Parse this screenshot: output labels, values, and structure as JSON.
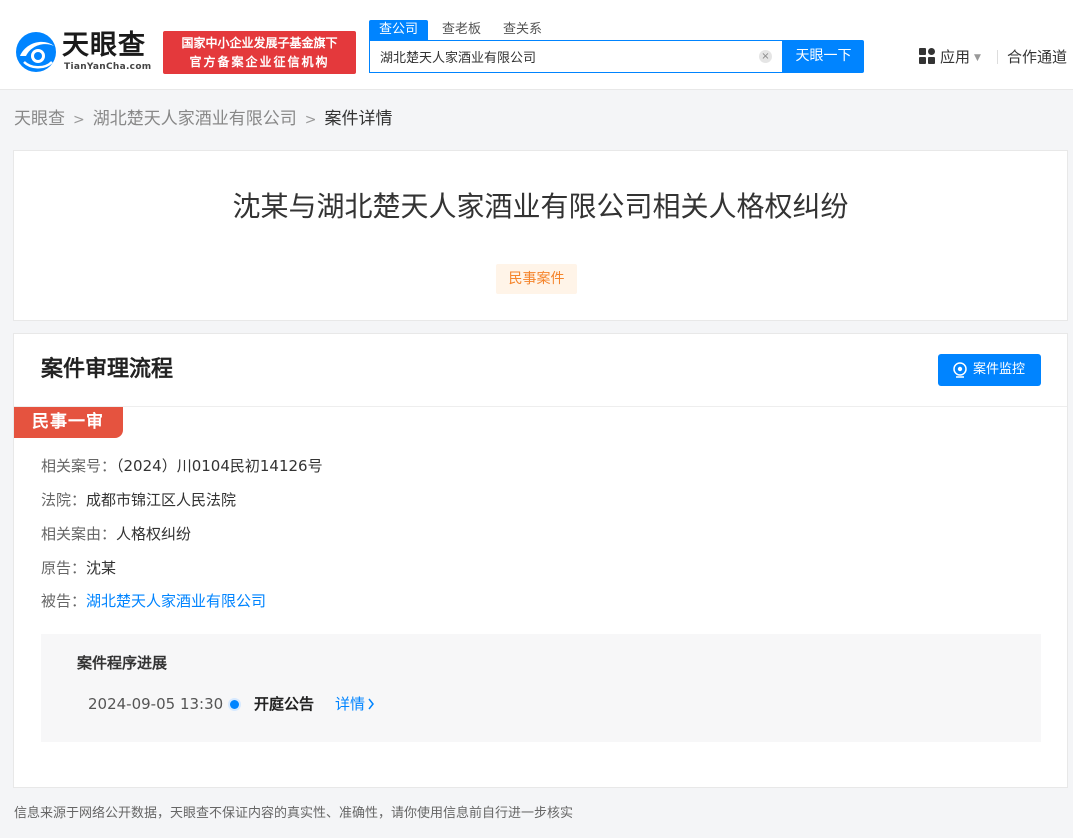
{
  "header": {
    "logo_text": "天眼查",
    "logo_sub": "TianYanCha.com",
    "slogan_line1": "国家中小企业发展子基金旗下",
    "slogan_line2": "官方备案企业征信机构",
    "search_tabs": [
      {
        "label": "查公司",
        "active": true
      },
      {
        "label": "查老板",
        "active": false
      },
      {
        "label": "查关系",
        "active": false
      }
    ],
    "search_value": "湖北楚天人家酒业有限公司",
    "search_button": "天眼一下",
    "nav_apps": "应用",
    "nav_partner": "合作通道"
  },
  "breadcrumb": {
    "items": [
      "天眼查",
      "湖北楚天人家酒业有限公司"
    ],
    "current": "案件详情"
  },
  "case": {
    "title": "沈某与湖北楚天人家酒业有限公司相关人格权纠纷",
    "tag": "民事案件"
  },
  "process": {
    "section_title": "案件审理流程",
    "monitor_button": "案件监控",
    "stage": "民事一审",
    "fields": [
      {
        "key": "相关案号：",
        "value": "（2024）川0104民初14126号",
        "link": false
      },
      {
        "key": "法院：",
        "value": "成都市锦江区人民法院",
        "link": false
      },
      {
        "key": "相关案由：",
        "value": "人格权纠纷",
        "link": false
      },
      {
        "key": "原告：",
        "value": "沈某",
        "link": false
      },
      {
        "key": "被告：",
        "value": "湖北楚天人家酒业有限公司",
        "link": true
      }
    ],
    "progress": {
      "title": "案件程序进展",
      "time": "2024-09-05 13:30",
      "event": "开庭公告",
      "detail": "详情"
    }
  },
  "footer": "信息来源于网络公开数据，天眼查不保证内容的真实性、准确性，请你使用信息前自行进一步核实",
  "colors": {
    "brand_blue": "#0084ff",
    "slogan_red": "#e4393c",
    "stage_red": "#e5533f",
    "tag_orange": "#f5842b"
  }
}
